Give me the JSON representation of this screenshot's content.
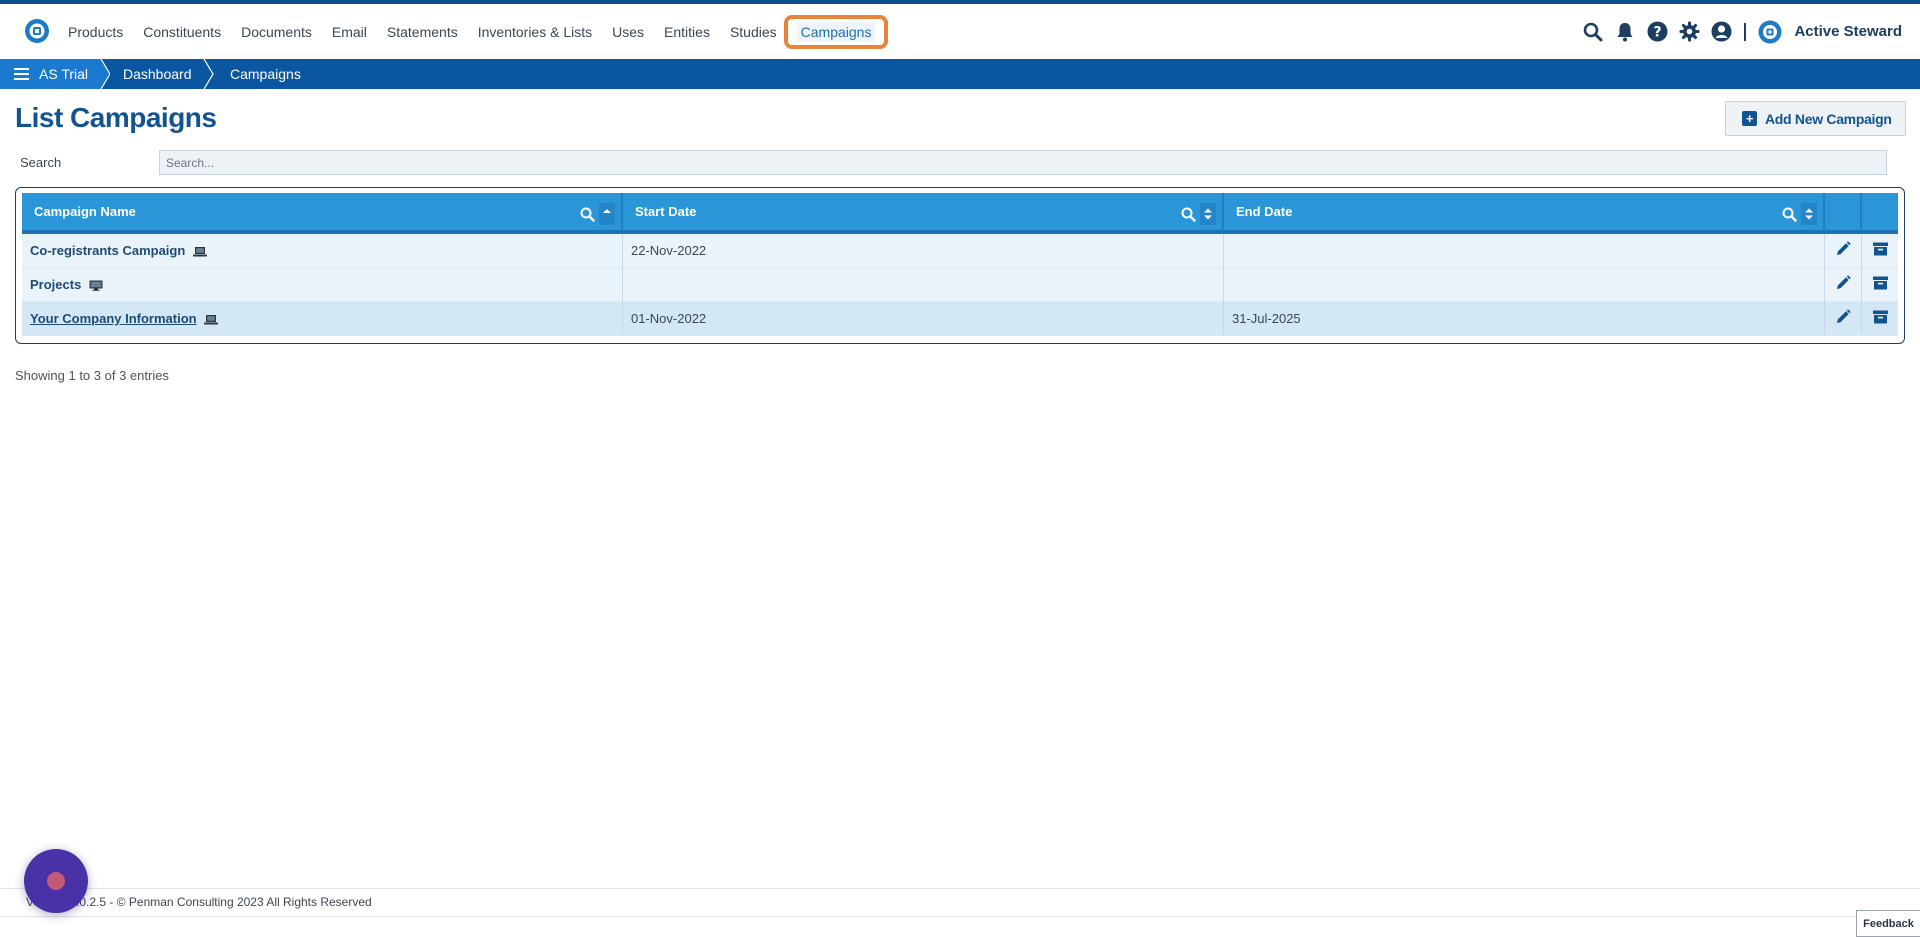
{
  "nav": {
    "items": [
      {
        "label": "Products"
      },
      {
        "label": "Constituents"
      },
      {
        "label": "Documents"
      },
      {
        "label": "Email"
      },
      {
        "label": "Statements"
      },
      {
        "label": "Inventories & Lists"
      },
      {
        "label": "Uses"
      },
      {
        "label": "Entities"
      },
      {
        "label": "Studies"
      },
      {
        "label": "Campaigns",
        "active": true
      }
    ],
    "right_icons": [
      "search-icon",
      "bell-icon",
      "help-icon",
      "gear-icon",
      "user-icon"
    ],
    "brand_name": "Active Steward"
  },
  "breadcrumb": {
    "items": [
      "AS Trial",
      "Dashboard",
      "Campaigns"
    ]
  },
  "page": {
    "title": "List Campaigns",
    "add_button": "Add New Campaign",
    "search_label": "Search",
    "search_placeholder": "Search..."
  },
  "table": {
    "columns": [
      "Campaign Name",
      "Start Date",
      "End Date"
    ],
    "rows": [
      {
        "name": "Co-registrants Campaign",
        "start": "22-Nov-2022",
        "end": ""
      },
      {
        "name": "Projects",
        "start": "",
        "end": ""
      },
      {
        "name": "Your Company Information",
        "start": "01-Nov-2022",
        "end": "31-Jul-2025"
      }
    ],
    "entries_text": "Showing 1 to 3 of 3 entries"
  },
  "footer": {
    "text": "Version 6.0.2.5 - © Penman Consulting 2023 All Rights Reserved",
    "feedback": "Feedback"
  },
  "colors": {
    "primary": "#12548f",
    "header_blue": "#2a96d8",
    "breadcrumb_bar": "#0b56a0",
    "highlight": "#e8833a"
  }
}
